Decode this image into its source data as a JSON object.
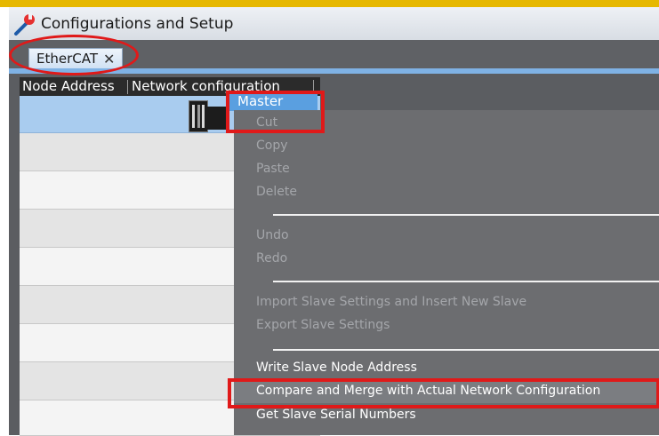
{
  "window": {
    "title": "Configurations and Setup"
  },
  "tab": {
    "label": "EtherCAT",
    "close_glyph": "✕"
  },
  "grid": {
    "columns": [
      "Node Address",
      "Network configuration"
    ]
  },
  "master": {
    "label": "Master"
  },
  "context_menu": {
    "items": [
      {
        "label": "Cut",
        "enabled": false
      },
      {
        "label": "Copy",
        "enabled": false
      },
      {
        "label": "Paste",
        "enabled": false
      },
      {
        "label": "Delete",
        "enabled": false
      },
      {
        "label": "Undo",
        "enabled": false
      },
      {
        "label": "Redo",
        "enabled": false
      },
      {
        "label": "Import Slave Settings and Insert New Slave",
        "enabled": false
      },
      {
        "label": "Export Slave Settings",
        "enabled": false
      },
      {
        "label": "Write Slave Node Address",
        "enabled": true
      },
      {
        "label": "Compare and Merge with Actual Network Configuration",
        "enabled": true,
        "highlighted": true
      },
      {
        "label": "Get Slave Serial Numbers",
        "enabled": true
      }
    ]
  },
  "colors": {
    "annotation": "#e01919",
    "selection": "#a9ccef",
    "menu_background": "#6c6d70"
  },
  "icons": {
    "title": "wrench-icon",
    "tab_close": "close-icon",
    "master": "controller-icon"
  }
}
